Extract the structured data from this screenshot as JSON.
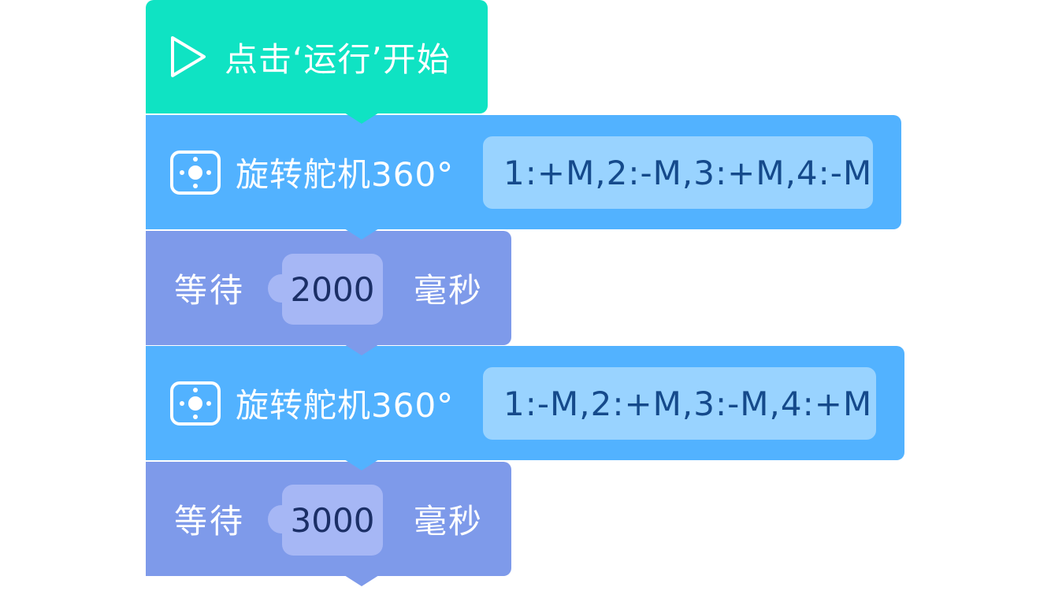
{
  "start_block": {
    "label": "点击‘运行’开始",
    "icon": "play-icon",
    "color": "#0fe3c3"
  },
  "program": [
    {
      "type": "servo",
      "label": "旋转舵机360°",
      "icon": "servo-icon",
      "param": "1:+M,2:-M,3:+M,4:-M",
      "color": "#52b2ff"
    },
    {
      "type": "wait",
      "label": "等待",
      "value": "2000",
      "unit": "毫秒",
      "color": "#7e9aea"
    },
    {
      "type": "servo",
      "label": "旋转舵机360°",
      "icon": "servo-icon",
      "param": "1:-M,2:+M,3:-M,4:+M",
      "color": "#52b2ff"
    },
    {
      "type": "wait",
      "label": "等待",
      "value": "3000",
      "unit": "毫秒",
      "color": "#7e9aea"
    }
  ]
}
